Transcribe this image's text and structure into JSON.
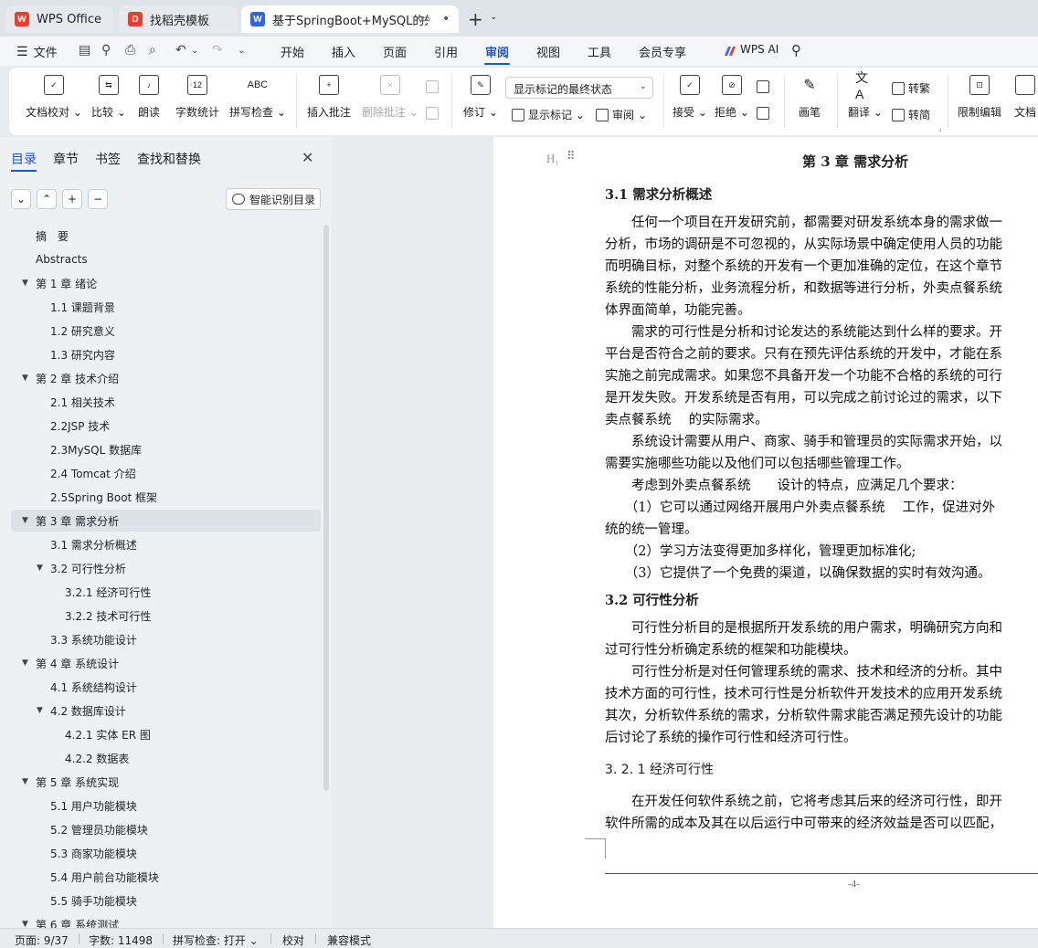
{
  "tabs": [
    {
      "title": "WPS Office",
      "logo": "W",
      "logo_color": "#e8402f"
    },
    {
      "title": "找稻壳模板",
      "logo": "D",
      "logo_color": "#e8402f"
    },
    {
      "title": "基于SpringBoot+MySQL的外",
      "logo": "W",
      "logo_color": "#2f64e6"
    }
  ],
  "menu": {
    "file": "文件",
    "items": [
      "开始",
      "插入",
      "页面",
      "引用",
      "审阅",
      "视图",
      "工具",
      "会员专享"
    ],
    "active": "审阅",
    "ai": "WPS AI"
  },
  "ribbon": {
    "buttons": [
      {
        "label": "文档校对",
        "caret": true,
        "icon": "doc-check-icon",
        "glyph": "✓"
      },
      {
        "label": "比较",
        "caret": true,
        "icon": "compare-icon",
        "glyph": "⇆"
      },
      {
        "label": "朗读",
        "caret": false,
        "icon": "read-aloud-icon",
        "glyph": "♪"
      },
      {
        "label": "字数统计",
        "caret": false,
        "icon": "word-count-icon",
        "glyph": "12"
      },
      {
        "label": "拼写检查",
        "caret": true,
        "icon": "spell-check-icon",
        "glyph": "ABC"
      },
      {
        "label": "插入批注",
        "caret": false,
        "icon": "insert-comment-icon",
        "glyph": "+"
      },
      {
        "label": "删除批注",
        "caret": true,
        "icon": "delete-comment-icon",
        "glyph": "×",
        "disabled": true
      },
      {
        "label": "修订",
        "caret": true,
        "icon": "revise-icon",
        "glyph": "✎"
      },
      {
        "label": "接受",
        "caret": true,
        "icon": "accept-icon",
        "glyph": "✓"
      },
      {
        "label": "拒绝",
        "caret": true,
        "icon": "reject-icon",
        "glyph": "⊘"
      },
      {
        "label": "画笔",
        "caret": false,
        "icon": "pen-icon",
        "glyph": "✎"
      },
      {
        "label": "翻译",
        "caret": true,
        "icon": "translate-icon",
        "glyph": "A"
      },
      {
        "label": "限制编辑",
        "caret": false,
        "icon": "restrict-edit-icon",
        "glyph": "🔒"
      },
      {
        "label": "文档",
        "caret": false,
        "icon": "doc-icon",
        "glyph": ""
      }
    ],
    "markup_select": "显示标记的最终状态",
    "show_markup": "显示标记",
    "review": "审阅",
    "to_traditional": "转繁",
    "to_simplified": "转简"
  },
  "nav": {
    "tabs": [
      "目录",
      "章节",
      "书签",
      "查找和替换"
    ],
    "active_tab": "目录",
    "smart_toc": "智能识别目录",
    "toc": [
      {
        "label": "摘　要",
        "level": 1,
        "arrow": false
      },
      {
        "label": "Abstracts",
        "level": 1,
        "arrow": false
      },
      {
        "label": "第 1 章  绪论",
        "level": 1,
        "arrow": true
      },
      {
        "label": "1.1 课题背景",
        "level": 2,
        "arrow": false
      },
      {
        "label": "1.2 研究意义",
        "level": 2,
        "arrow": false
      },
      {
        "label": "1.3 研究内容",
        "level": 2,
        "arrow": false
      },
      {
        "label": "第 2 章  技术介绍",
        "level": 1,
        "arrow": true
      },
      {
        "label": "2.1 相关技术",
        "level": 2,
        "arrow": false
      },
      {
        "label": "2.2JSP 技术",
        "level": 2,
        "arrow": false
      },
      {
        "label": "2.3MySQL 数据库",
        "level": 2,
        "arrow": false
      },
      {
        "label": "2.4 Tomcat 介绍",
        "level": 2,
        "arrow": false
      },
      {
        "label": "2.5Spring Boot 框架",
        "level": 2,
        "arrow": false
      },
      {
        "label": "第 3 章  需求分析",
        "level": 1,
        "arrow": true,
        "selected": true
      },
      {
        "label": "3.1 需求分析概述",
        "level": 2,
        "arrow": false
      },
      {
        "label": "3.2 可行性分析",
        "level": 2,
        "arrow": true
      },
      {
        "label": "3.2.1 经济可行性",
        "level": 3,
        "arrow": false
      },
      {
        "label": "3.2.2 技术可行性",
        "level": 3,
        "arrow": false
      },
      {
        "label": "3.3 系统功能设计",
        "level": 2,
        "arrow": false
      },
      {
        "label": "第 4 章  系统设计",
        "level": 1,
        "arrow": true
      },
      {
        "label": "4.1 系统结构设计",
        "level": 2,
        "arrow": false
      },
      {
        "label": "4.2 数据库设计",
        "level": 2,
        "arrow": true
      },
      {
        "label": "4.2.1 实体 ER 图",
        "level": 3,
        "arrow": false
      },
      {
        "label": "4.2.2 数据表",
        "level": 3,
        "arrow": false
      },
      {
        "label": "第 5 章  系统实现",
        "level": 1,
        "arrow": true
      },
      {
        "label": "5.1 用户功能模块",
        "level": 2,
        "arrow": false
      },
      {
        "label": "5.2 管理员功能模块",
        "level": 2,
        "arrow": false
      },
      {
        "label": "5.3 商家功能模块",
        "level": 2,
        "arrow": false
      },
      {
        "label": "5.4 用户前台功能模块",
        "level": 2,
        "arrow": false
      },
      {
        "label": "5.5 骑手功能模块",
        "level": 2,
        "arrow": false
      },
      {
        "label": "第 6 章  系统测试",
        "level": 1,
        "arrow": true
      }
    ]
  },
  "document": {
    "chapter_title": "第 3 章  需求分析",
    "blocks": [
      {
        "type": "h2",
        "text": "3.1 需求分析概述"
      },
      {
        "type": "p",
        "text": "　　任何一个项目在开发研究前，都需要对研发系统本身的需求做一"
      },
      {
        "type": "p",
        "text": "分析，市场的调研是不可忽视的，从实际场景中确定使用人员的功能"
      },
      {
        "type": "p",
        "text": "而明确目标，对整个系统的开发有一个更加准确的定位，在这个章节"
      },
      {
        "type": "p",
        "text": "系统的性能分析，业务流程分析，和数据等进行分析，外卖点餐系统"
      },
      {
        "type": "p",
        "text": "体界面简单，功能完善。"
      },
      {
        "type": "p",
        "text": "　　需求的可行性是分析和讨论发达的系统能达到什么样的要求。开"
      },
      {
        "type": "p",
        "text": "平台是否符合之前的要求。只有在预先评估系统的开发中，才能在系"
      },
      {
        "type": "p",
        "text": "实施之前完成需求。如果您不具备开发一个功能不合格的系统的可行"
      },
      {
        "type": "p",
        "text": "是开发失败。开发系统是否有用，可以完成之前讨论过的需求，以下"
      },
      {
        "type": "p",
        "text": "卖点餐系统　 的实际需求。"
      },
      {
        "type": "p",
        "text": "　　系统设计需要从用户、商家、骑手和管理员的实际需求开始，以"
      },
      {
        "type": "p",
        "text": "需要实施哪些功能以及他们可以包括哪些管理工作。"
      },
      {
        "type": "p",
        "text": "　　考虑到外卖点餐系统　　设计的特点，应满足几个要求："
      },
      {
        "type": "p",
        "text": "　　（1）它可以通过网络开展用户外卖点餐系统　 工作，促进对外"
      },
      {
        "type": "p",
        "text": "统的统一管理。"
      },
      {
        "type": "p",
        "text": "　　（2）学习方法变得更加多样化，管理更加标准化;"
      },
      {
        "type": "p",
        "text": "　　（3）它提供了一个免费的渠道，以确保数据的实时有效沟通。"
      },
      {
        "type": "h2",
        "text": "3.2 可行性分析"
      },
      {
        "type": "p",
        "text": "　　可行性分析目的是根据所开发系统的用户需求，明确研究方向和"
      },
      {
        "type": "p",
        "text": "过可行性分析确定系统的框架和功能模块。"
      },
      {
        "type": "p",
        "text": "　　可行性分析是对任何管理系统的需求、技术和经济的分析。其中"
      },
      {
        "type": "p",
        "text": "技术方面的可行性，技术可行性是分析软件开发技术的应用开发系统"
      },
      {
        "type": "p",
        "text": "其次，分析软件系统的需求，分析软件需求能否满足预先设计的功能"
      },
      {
        "type": "p",
        "text": "后讨论了系统的操作可行性和经济可行性。"
      },
      {
        "type": "h3",
        "text": "3. 2. 1 经济可行性"
      },
      {
        "type": "p",
        "text": "　　在开发任何软件系统之前，它将考虑其后来的经济可行性，即开"
      },
      {
        "type": "p",
        "text": "软件所需的成本及其在以后运行中可带来的经济效益是否可以匹配，"
      }
    ],
    "page_number": "-4-"
  },
  "status": {
    "page": "页面: 9/37",
    "words": "字数: 11498",
    "spell": "拼写检查: 打开",
    "proof": "校对",
    "compat": "兼容模式"
  }
}
